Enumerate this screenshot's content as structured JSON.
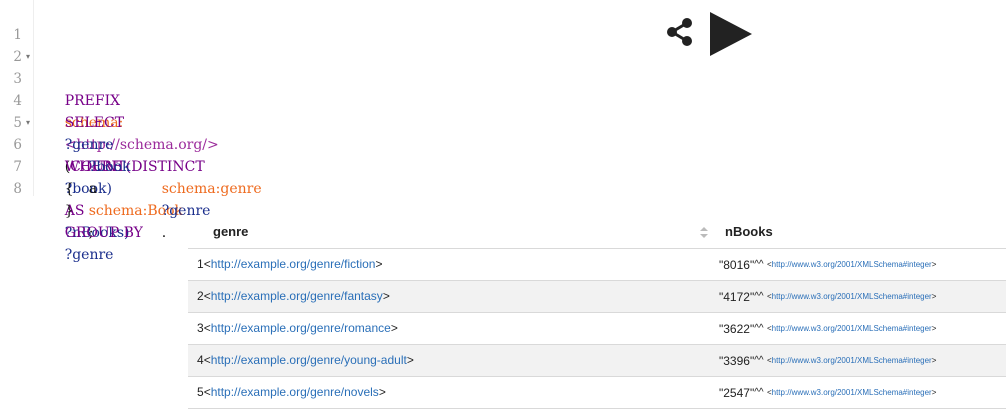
{
  "editor": {
    "lines": [
      {
        "num": "1",
        "fold": "▾"
      },
      {
        "num": "2",
        "fold": ""
      },
      {
        "num": "3",
        "fold": ""
      },
      {
        "num": "4",
        "fold": "▾"
      },
      {
        "num": "5",
        "fold": ""
      },
      {
        "num": "6",
        "fold": ""
      },
      {
        "num": "7",
        "fold": ""
      },
      {
        "num": "8",
        "fold": ""
      }
    ],
    "tokens": {
      "l1_kw": "PREFIX",
      "l1_pfx": "schema:",
      "l1_uri": "<http://schema.org/>",
      "l3_kw": "SELECT",
      "l3_var1": "?genre",
      "l3_open": "(",
      "l3_fn": "COUNT(DISTINCT",
      "l3_var2": "?book)",
      "l3_as": "AS",
      "l3_var3": "?nBooks)",
      "l4_kw": "WHERE",
      "l4_brace": "{",
      "l5_var": "?book",
      "l5_a": "a",
      "l5_pfx": "schema:Book",
      "l5_semi": ";",
      "l6_pfx": "schema:genre",
      "l6_var": "?genre",
      "l6_dot": ".",
      "l7_brace": "}",
      "l8_kw": "GROUP BY",
      "l8_var": "?genre"
    },
    "toolbar": {
      "share_icon": "share-icon",
      "run_icon": "play-icon"
    }
  },
  "results": {
    "columns": [
      "genre",
      "nBooks"
    ],
    "rows": [
      {
        "num": "1",
        "genre_uri": "http://example.org/genre/fiction",
        "count": "\"8016\"",
        "caret": "^^",
        "dtype": "http://www.w3.org/2001/XMLSchema#integer"
      },
      {
        "num": "2",
        "genre_uri": "http://example.org/genre/fantasy",
        "count": "\"4172\"",
        "caret": "^^",
        "dtype": "http://www.w3.org/2001/XMLSchema#integer"
      },
      {
        "num": "3",
        "genre_uri": "http://example.org/genre/romance",
        "count": "\"3622\"",
        "caret": "^^",
        "dtype": "http://www.w3.org/2001/XMLSchema#integer"
      },
      {
        "num": "4",
        "genre_uri": "http://example.org/genre/young-adult",
        "count": "\"3396\"",
        "caret": "^^",
        "dtype": "http://www.w3.org/2001/XMLSchema#integer"
      },
      {
        "num": "5",
        "genre_uri": "http://example.org/genre/novels",
        "count": "\"2547\"",
        "caret": "^^",
        "dtype": "http://www.w3.org/2001/XMLSchema#integer"
      }
    ],
    "lt": "<",
    "gt": ">",
    "colors": {
      "link": "#2a6fb8",
      "stripe": "#f2f2f2"
    }
  }
}
